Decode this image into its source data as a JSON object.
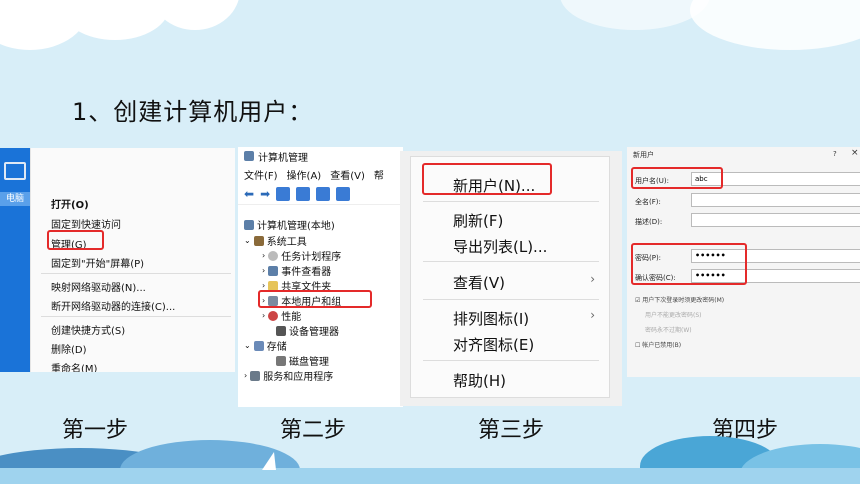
{
  "slide": {
    "title": "1、创建计算机用户："
  },
  "step1": {
    "desktop_label": "电脑",
    "items": [
      "打开(O)",
      "固定到快速访问",
      "管理(G)",
      "固定到\"开始\"屏幕(P)",
      "映射网络驱动器(N)...",
      "断开网络驱动器的连接(C)...",
      "创建快捷方式(S)",
      "删除(D)",
      "重命名(M)"
    ]
  },
  "step2": {
    "window_title": "计算机管理",
    "menu": [
      "文件(F)",
      "操作(A)",
      "查看(V)",
      "帮"
    ],
    "tree": [
      "计算机管理(本地)",
      "系统工具",
      "任务计划程序",
      "事件查看器",
      "共享文件夹",
      "本地用户和组",
      "性能",
      "设备管理器",
      "存储",
      "磁盘管理",
      "服务和应用程序"
    ]
  },
  "step3": {
    "items": [
      "新用户(N)...",
      "刷新(F)",
      "导出列表(L)...",
      "查看(V)",
      "排列图标(I)",
      "对齐图标(E)",
      "帮助(H)"
    ]
  },
  "step4": {
    "dialog_title": "新用户",
    "help": "?",
    "close": "×",
    "username_label": "用户名(U):",
    "username_value": "abc",
    "fullname_label": "全名(F):",
    "description_label": "描述(D):",
    "password_label": "密码(P):",
    "password_value": "••••••",
    "confirm_label": "确认密码(C):",
    "confirm_value": "••••••",
    "options": [
      "☑ 用户下次登录时须更改密码(M)",
      "用户不能更改密码(S)",
      "密码永不过期(W)",
      "☐ 帐户已禁用(B)"
    ]
  },
  "steps": [
    "第一步",
    "第二步",
    "第三步",
    "第四步"
  ],
  "colors": {
    "background": "#d8eef8",
    "highlight": "#e42a2a",
    "desktop": "#1a73d8"
  }
}
